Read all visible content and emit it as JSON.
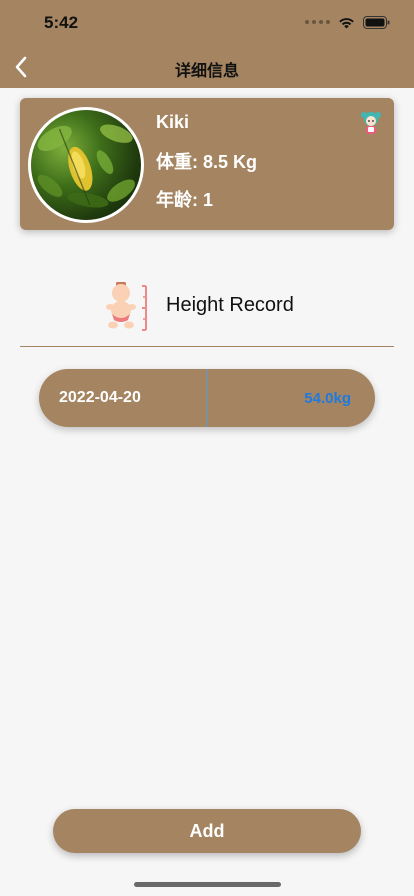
{
  "status_bar": {
    "time": "5:42"
  },
  "nav": {
    "title": "详细信息",
    "back_icon": "chevron-left-icon"
  },
  "profile": {
    "name": "Kiki",
    "weight_label": "体重: 8.5 Kg",
    "age_label": "年龄: 1"
  },
  "section": {
    "title": "Height Record"
  },
  "records": [
    {
      "date": "2022-04-20",
      "value": "54.0kg"
    }
  ],
  "actions": {
    "add_label": "Add"
  },
  "colors": {
    "brand_brown": "#a48461",
    "background": "#f6f6f6",
    "value_blue": "#1f7ae0"
  }
}
